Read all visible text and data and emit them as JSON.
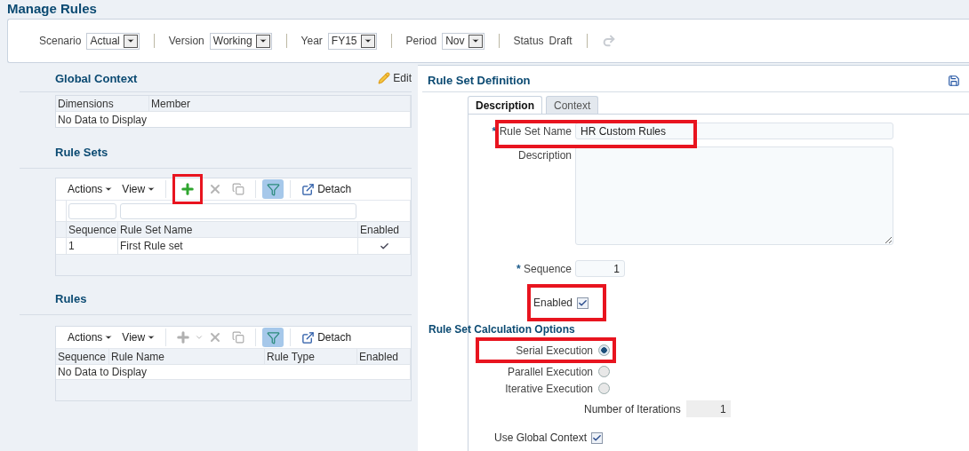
{
  "title": "Manage Rules",
  "filters": [
    {
      "label": "Scenario",
      "value": "Actual"
    },
    {
      "label": "Version",
      "value": "Working"
    },
    {
      "label": "Year",
      "value": "FY15"
    },
    {
      "label": "Period",
      "value": "Nov"
    }
  ],
  "status": {
    "label": "Status",
    "value": "Draft"
  },
  "global_context": {
    "title": "Global Context",
    "edit": "Edit",
    "columns": [
      "Dimensions",
      "Member"
    ],
    "empty": "No Data to Display"
  },
  "rule_sets": {
    "title": "Rule Sets",
    "toolbar": {
      "actions": "Actions",
      "view": "View",
      "detach": "Detach",
      "add_disabled": false,
      "add_highlighted": true
    },
    "columns": [
      "Sequence",
      "Rule Set Name",
      "Enabled"
    ],
    "rows": [
      {
        "sequence": "1",
        "name": "First Rule set",
        "enabled": true
      }
    ]
  },
  "rules": {
    "title": "Rules",
    "toolbar": {
      "actions": "Actions",
      "view": "View",
      "detach": "Detach",
      "add_disabled": true,
      "add_highlighted": false
    },
    "columns": [
      "Sequence",
      "Rule Name",
      "Rule Type",
      "Enabled"
    ],
    "empty": "No Data to Display"
  },
  "definition": {
    "title": "Rule Set Definition",
    "tabs": [
      {
        "label": "Description",
        "selected": true
      },
      {
        "label": "Context",
        "selected": false
      }
    ],
    "name": {
      "mark": "*",
      "label": "Rule Set Name",
      "value": "HR Custom Rules",
      "highlighted": true
    },
    "description": {
      "label": "Description"
    },
    "sequence": {
      "mark": "*",
      "label": "Sequence",
      "value": "1"
    },
    "enabled": {
      "label": "Enabled",
      "checked": true,
      "highlighted": true
    },
    "options_title": "Rule Set Calculation Options",
    "execution": [
      {
        "label": "Serial Execution",
        "selected": true,
        "highlighted": true
      },
      {
        "label": "Parallel Execution",
        "selected": false,
        "highlighted": false
      },
      {
        "label": "Iterative Execution",
        "selected": false,
        "highlighted": false
      }
    ],
    "iterations": {
      "label": "Number of Iterations",
      "value": "1"
    },
    "use_global_context": {
      "label": "Use Global Context",
      "checked": true
    }
  }
}
